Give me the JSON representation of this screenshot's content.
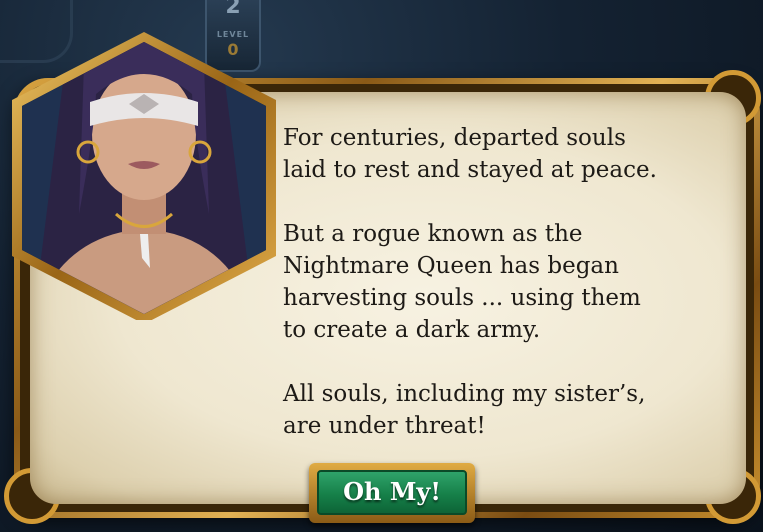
{
  "hud": {
    "top_number": "2",
    "level_label": "LEVEL",
    "level_value": "0"
  },
  "dialog": {
    "paragraphs": [
      "For centuries, departed souls\nlaid to rest and stayed at peace.",
      "But a rogue known as the\nNightmare Queen has began\nharvesting souls ... using them\nto create a dark army.",
      "All souls, including my sister’s,\nare under threat!"
    ],
    "button_label": "Oh My!"
  },
  "colors": {
    "frame_gold": "#d29a35",
    "parchment": "#efe7d0",
    "button_green": "#168049",
    "portrait_bg": "#1c2c4a"
  },
  "icons": {
    "portrait": "blindfolded-woman-portrait"
  }
}
